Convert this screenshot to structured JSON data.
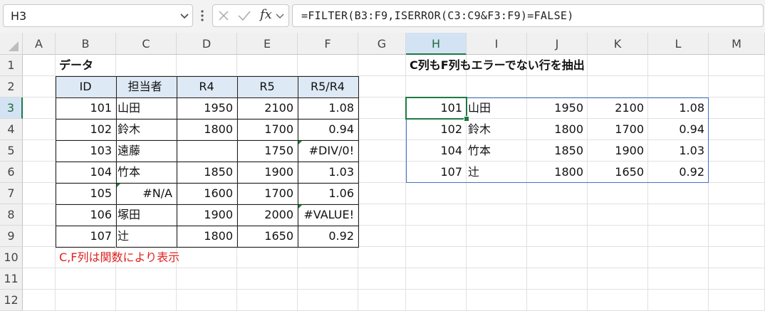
{
  "name_box": {
    "value": "H3"
  },
  "formula_bar": {
    "fx_label": "fx",
    "formula": "=FILTER(B3:F9,ISERROR(C3:C9&F3:F9)=FALSE)"
  },
  "columns": [
    "A",
    "B",
    "C",
    "D",
    "E",
    "F",
    "G",
    "H",
    "I",
    "J",
    "K",
    "L",
    "M"
  ],
  "rows": [
    "1",
    "2",
    "3",
    "4",
    "5",
    "6",
    "7",
    "8",
    "9",
    "10",
    "11",
    "12"
  ],
  "selected_column": "H",
  "selected_row": "3",
  "cells": {
    "B1": "データ",
    "B2": "ID",
    "C2": "担当者",
    "D2": "R4",
    "E2": "R5",
    "F2": "R5/R4",
    "B3": "101",
    "C3": "山田",
    "D3": "1950",
    "E3": "2100",
    "F3": "1.08",
    "B4": "102",
    "C4": "鈴木",
    "D4": "1800",
    "E4": "1700",
    "F4": "0.94",
    "B5": "103",
    "C5": "遠藤",
    "D5": "",
    "E5": "1750",
    "F5": "#DIV/0!",
    "B6": "104",
    "C6": "竹本",
    "D6": "1850",
    "E6": "1900",
    "F6": "1.03",
    "B7": "105",
    "C7": "#N/A",
    "D7": "1600",
    "E7": "1700",
    "F7": "1.06",
    "B8": "106",
    "C8": "塚田",
    "D8": "1900",
    "E8": "2000",
    "F8": "#VALUE!",
    "B9": "107",
    "C9": "辻",
    "D9": "1800",
    "E9": "1650",
    "F9": "0.92",
    "B10": "C,F列は関数により表示",
    "H1": "C列もF列もエラーでない行を抽出",
    "H3": "101",
    "I3": "山田",
    "J3": "1950",
    "K3": "2100",
    "L3": "1.08",
    "H4": "102",
    "I4": "鈴木",
    "J4": "1800",
    "K4": "1700",
    "L4": "0.94",
    "H5": "104",
    "I5": "竹本",
    "J5": "1850",
    "K5": "1900",
    "L5": "1.03",
    "H6": "107",
    "I6": "辻",
    "J6": "1800",
    "K6": "1650",
    "L6": "0.92"
  },
  "colors": {
    "note_text": "#e02020",
    "header_fill": "#dde9f5",
    "spill_border": "#4472c4",
    "selection": "#1f7a44",
    "error_marker": "#1a7f37"
  }
}
